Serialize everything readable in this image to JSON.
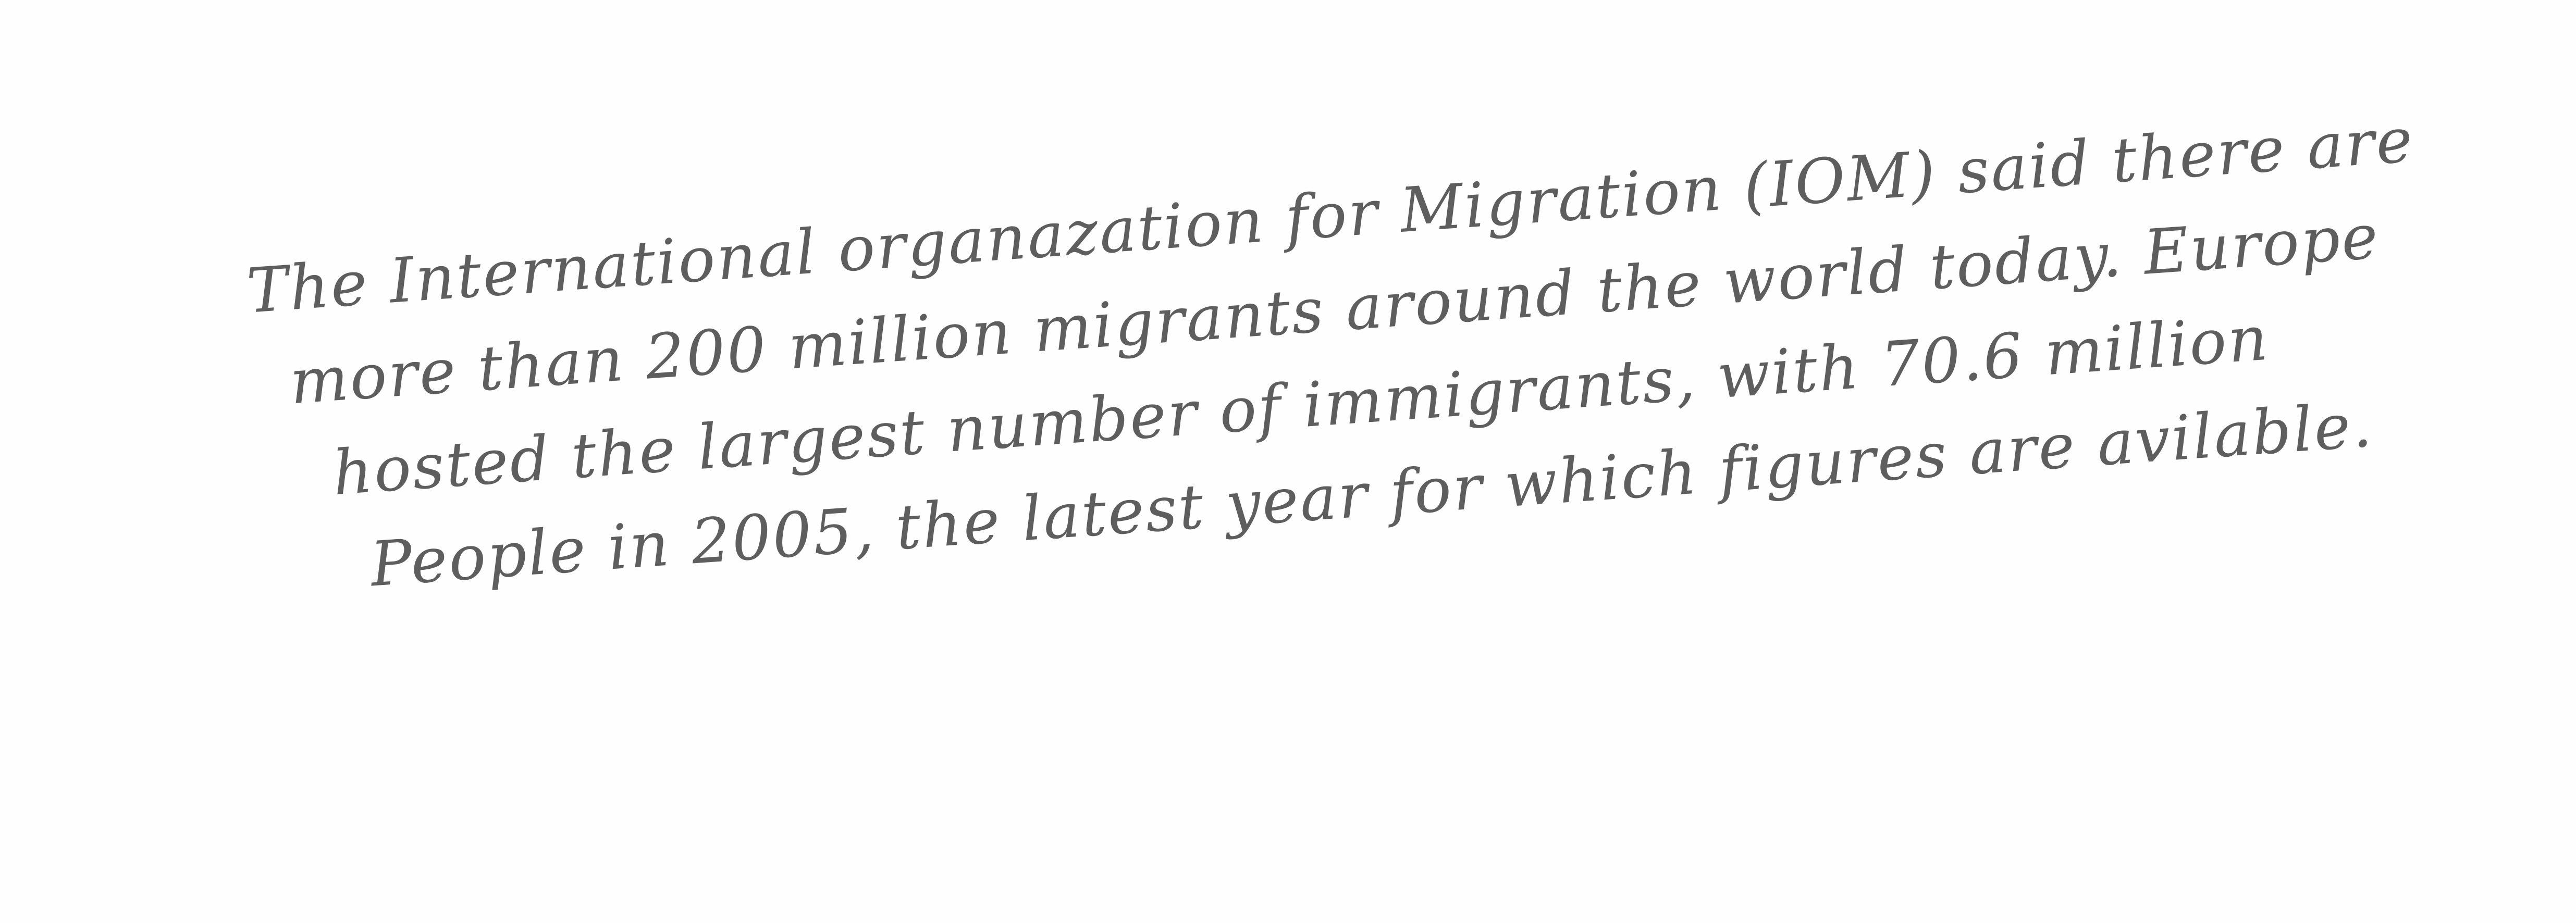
{
  "document": {
    "lines": [
      "The International organazation for Migration (IOM) said there are",
      "more than 200 million migrants around the world today. Europe",
      "hosted the largest number of immigrants, with 70.6 million",
      "People in 2005, the latest year for which figures are avilable."
    ]
  },
  "colors": {
    "paper": "#fefefe",
    "ink": "#5e5e5e"
  }
}
